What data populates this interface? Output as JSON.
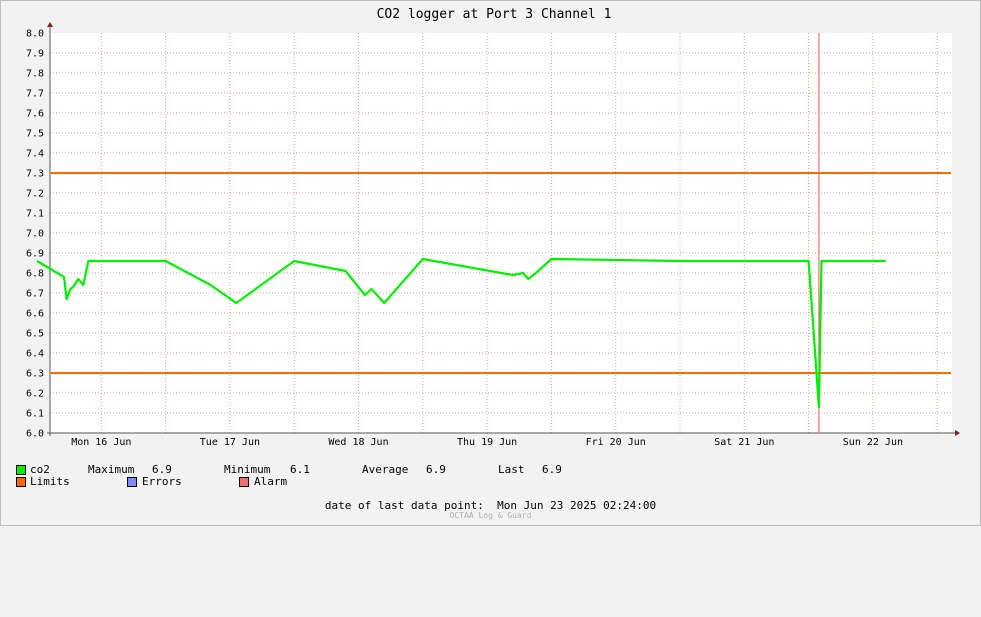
{
  "chart_data": {
    "type": "line",
    "title": "CO2 logger at Port 3 Channel 1",
    "ylim": [
      6.0,
      8.0
    ],
    "y_ticks": [
      "6.0",
      "6.1",
      "6.2",
      "6.3",
      "6.4",
      "6.5",
      "6.6",
      "6.7",
      "6.8",
      "6.9",
      "7.0",
      "7.1",
      "7.2",
      "7.3",
      "7.4",
      "7.5",
      "7.6",
      "7.7",
      "7.8",
      "7.9",
      "8.0"
    ],
    "x_ticks": [
      "Mon 16 Jun",
      "Tue 17 Jun",
      "Wed 18 Jun",
      "Thu 19 Jun",
      "Fri 20 Jun",
      "Sat 21 Jun",
      "Sun 22 Jun"
    ],
    "grid": true,
    "limits": [
      6.3,
      7.3
    ],
    "alarm_at_day": 6.08,
    "series": [
      {
        "name": "co2",
        "color": "#00ee00",
        "baseline": 6.86,
        "x_days": [
          0.0,
          0.21,
          0.23,
          0.26,
          0.28,
          0.32,
          0.36,
          0.4,
          0.5,
          1.0,
          1.35,
          1.55,
          2.0,
          2.4,
          2.55,
          2.6,
          2.7,
          3.0,
          3.7,
          3.78,
          3.82,
          3.88,
          4.0,
          5.0,
          6.0,
          6.08,
          6.1,
          6.5,
          6.6
        ],
        "values": [
          6.86,
          6.78,
          6.67,
          6.72,
          6.73,
          6.77,
          6.74,
          6.86,
          6.86,
          6.86,
          6.74,
          6.65,
          6.86,
          6.81,
          6.69,
          6.72,
          6.65,
          6.87,
          6.79,
          6.8,
          6.77,
          6.8,
          6.87,
          6.86,
          6.86,
          6.13,
          6.86,
          6.86,
          6.86
        ]
      }
    ]
  },
  "legend": {
    "co2_label": "co2",
    "maximum_label": "Maximum",
    "maximum_value": "6.9",
    "minimum_label": "Minimum",
    "minimum_value": "6.1",
    "average_label": "Average",
    "average_value": "6.9",
    "last_label": "Last",
    "last_value": "6.9",
    "limits_label": "Limits",
    "errors_label": "Errors",
    "alarm_label": "Alarm",
    "colors": {
      "co2": "#00ee00",
      "limits": "#ff6a00",
      "errors": "#7b8cff",
      "alarm": "#f07070"
    }
  },
  "footer": {
    "last_point_label": "date of last data point:",
    "last_point_value": "Mon Jun 23 2025 02:24:00",
    "watermark": "OCTAA Log & Guard"
  }
}
